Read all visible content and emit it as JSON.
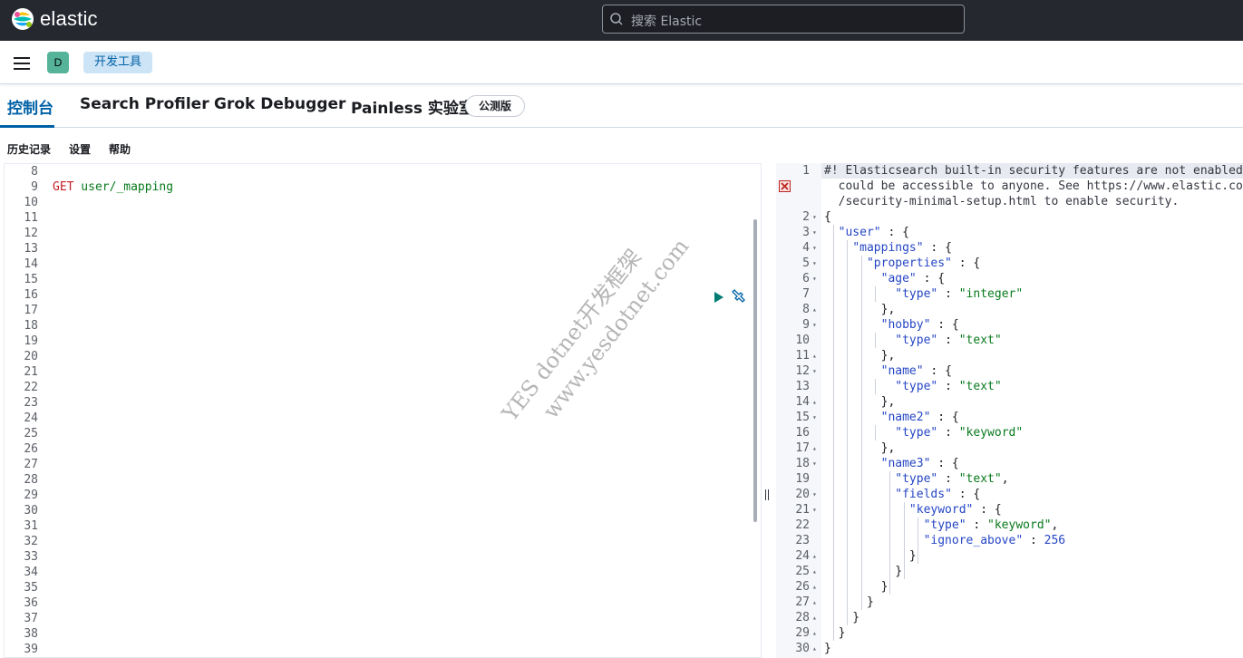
{
  "app": {
    "brand": "elastic",
    "search_placeholder": "搜索 Elastic"
  },
  "header": {
    "space_initial": "D",
    "breadcrumb": "开发工具"
  },
  "tabs": [
    {
      "label": "控制台",
      "active": true
    },
    {
      "label": "Search Profiler"
    },
    {
      "label": "Grok Debugger"
    },
    {
      "label": "Painless 实验室"
    }
  ],
  "beta_badge": "公测版",
  "menu": {
    "history": "历史记录",
    "settings": "设置",
    "help": "帮助"
  },
  "request": {
    "line_start": 8,
    "line_end": 39,
    "query_line": 9,
    "method": "GET",
    "path": "user/_mapping"
  },
  "response": {
    "warning": [
      "#! Elasticsearch built-in security features are not enabled.",
      "  could be accessible to anyone. See https://www.elastic.co/",
      "  /security-minimal-setup.html to enable security."
    ],
    "lines": [
      {
        "n": 2,
        "fold": "▾",
        "text": "{"
      },
      {
        "n": 3,
        "fold": "▾",
        "text": "  \"user\" : {"
      },
      {
        "n": 4,
        "fold": "▾",
        "text": "    \"mappings\" : {"
      },
      {
        "n": 5,
        "fold": "▾",
        "text": "      \"properties\" : {"
      },
      {
        "n": 6,
        "fold": "▾",
        "text": "        \"age\" : {"
      },
      {
        "n": 7,
        "fold": "",
        "text": "          \"type\" : \"integer\""
      },
      {
        "n": 8,
        "fold": "▴",
        "text": "        },"
      },
      {
        "n": 9,
        "fold": "▾",
        "text": "        \"hobby\" : {"
      },
      {
        "n": 10,
        "fold": "",
        "text": "          \"type\" : \"text\""
      },
      {
        "n": 11,
        "fold": "▴",
        "text": "        },"
      },
      {
        "n": 12,
        "fold": "▾",
        "text": "        \"name\" : {"
      },
      {
        "n": 13,
        "fold": "",
        "text": "          \"type\" : \"text\""
      },
      {
        "n": 14,
        "fold": "▴",
        "text": "        },"
      },
      {
        "n": 15,
        "fold": "▾",
        "text": "        \"name2\" : {"
      },
      {
        "n": 16,
        "fold": "",
        "text": "          \"type\" : \"keyword\""
      },
      {
        "n": 17,
        "fold": "▴",
        "text": "        },"
      },
      {
        "n": 18,
        "fold": "▾",
        "text": "        \"name3\" : {"
      },
      {
        "n": 19,
        "fold": "",
        "text": "          \"type\" : \"text\","
      },
      {
        "n": 20,
        "fold": "▾",
        "text": "          \"fields\" : {"
      },
      {
        "n": 21,
        "fold": "▾",
        "text": "            \"keyword\" : {"
      },
      {
        "n": 22,
        "fold": "",
        "text": "              \"type\" : \"keyword\","
      },
      {
        "n": 23,
        "fold": "",
        "text": "              \"ignore_above\" : 256"
      },
      {
        "n": 24,
        "fold": "▴",
        "text": "            }"
      },
      {
        "n": 25,
        "fold": "▴",
        "text": "          }"
      },
      {
        "n": 26,
        "fold": "▴",
        "text": "        }"
      },
      {
        "n": 27,
        "fold": "▴",
        "text": "      }"
      },
      {
        "n": 28,
        "fold": "▴",
        "text": "    }"
      },
      {
        "n": 29,
        "fold": "▴",
        "text": "  }"
      },
      {
        "n": 30,
        "fold": "▴",
        "text": "}"
      }
    ]
  },
  "watermark": [
    "YES dotnet开发框架",
    "www.yesdotnet.com"
  ],
  "colors": {
    "header_bg": "#25282f",
    "accent": "#0061a6",
    "space_avatar": "#54b399",
    "run_button": "#017d73"
  }
}
